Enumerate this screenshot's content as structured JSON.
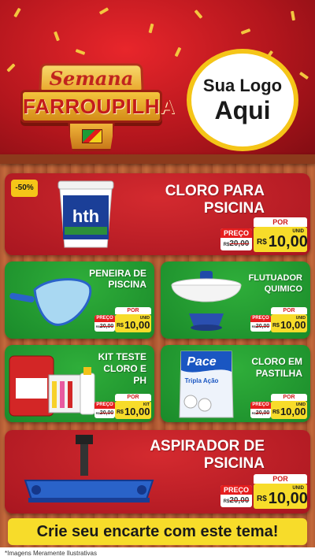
{
  "header": {
    "badge_top": "Semana",
    "badge_main": "FARROUPILHA",
    "logo_line1": "Sua Logo",
    "logo_line2": "Aqui"
  },
  "products": [
    {
      "title": "CLORO PARA PSICINA",
      "discount": "-50%",
      "por": "POR",
      "preco_label": "PREÇO",
      "old_prefix": "R$",
      "old_price": "20,00",
      "currency": "R$",
      "price": "10,00",
      "unit": "UNID"
    },
    {
      "title": "PENEIRA DE PISCINA",
      "por": "POR",
      "preco_label": "PREÇO",
      "old_prefix": "R$",
      "old_price": "20,00",
      "currency": "R$",
      "price": "10,00",
      "unit": "UNID"
    },
    {
      "title": "FLUTUADOR QUIMICO",
      "por": "POR",
      "preco_label": "PREÇO",
      "old_prefix": "R$",
      "old_price": "20,00",
      "currency": "R$",
      "price": "10,00",
      "unit": "UNID"
    },
    {
      "title": "KIT TESTE CLORO E PH",
      "por": "POR",
      "preco_label": "PREÇO",
      "old_prefix": "R$",
      "old_price": "20,00",
      "currency": "R$",
      "price": "10,00",
      "unit": "KIT"
    },
    {
      "title": "CLORO EM PASTILHA",
      "por": "POR",
      "preco_label": "PREÇO",
      "old_prefix": "R$",
      "old_price": "20,00",
      "currency": "R$",
      "price": "10,00",
      "unit": "UNID"
    },
    {
      "title": "ASPIRADOR DE PSICINA",
      "por": "POR",
      "preco_label": "PREÇO",
      "old_prefix": "R$",
      "old_price": "20,00",
      "currency": "R$",
      "price": "10,00",
      "unit": "UNID"
    }
  ],
  "bucket_brand": "hth",
  "bag_brand": "Pace",
  "bag_text": "Tripla Ação",
  "footer": "Crie seu encarte com este tema!",
  "disclaimer": "*Imagens Meramente Ilustrativas",
  "colors": {
    "red": "#c41c1c",
    "green": "#1f9a2f",
    "yellow": "#f7dc2a",
    "wood": "#b05a33"
  }
}
